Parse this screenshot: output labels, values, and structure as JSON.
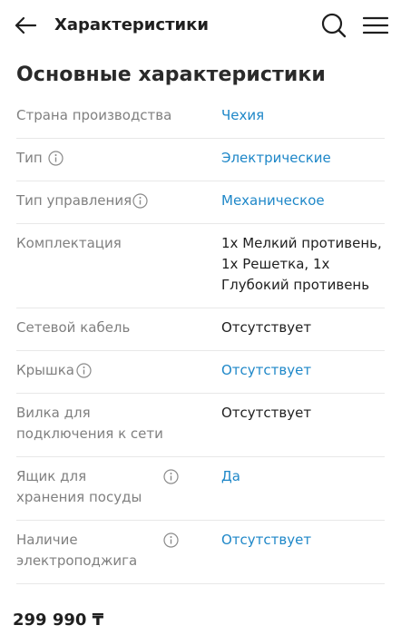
{
  "header": {
    "back_icon": "arrow-left-icon",
    "title": "Характеристики",
    "search_icon": "search-icon",
    "menu_icon": "hamburger-menu-icon"
  },
  "section": {
    "title": "Основные характеристики"
  },
  "specs": [
    {
      "label": "Страна производства",
      "value": "Чехия",
      "link": true,
      "info": false
    },
    {
      "label": "Тип",
      "value": "Электрические",
      "link": true,
      "info": true
    },
    {
      "label": "Тип управления",
      "value": "Механическое",
      "link": true,
      "info": true
    },
    {
      "label": "Комплектация",
      "value": "1x Мелкий противень, 1x Решетка, 1x Глубокий противень",
      "link": false,
      "info": false
    },
    {
      "label": "Сетевой кабель",
      "value": "Отсутствует",
      "link": false,
      "info": false
    },
    {
      "label": "Крышка",
      "value": "Отсутствует",
      "link": true,
      "info": true
    },
    {
      "label": "Вилка для подключения к сети",
      "value": "Отсутствует",
      "link": false,
      "info": false
    },
    {
      "label": "Ящик для хранения посуды",
      "value": "Да",
      "link": true,
      "info": true
    },
    {
      "label": "Наличие электроподжига",
      "value": "Отсутствует",
      "link": true,
      "info": true
    }
  ],
  "price": "299 990 ₸",
  "colors": {
    "link": "#1e87c8",
    "label": "#808080",
    "text": "#1f1f1f",
    "divider": "#e8e8e8"
  }
}
